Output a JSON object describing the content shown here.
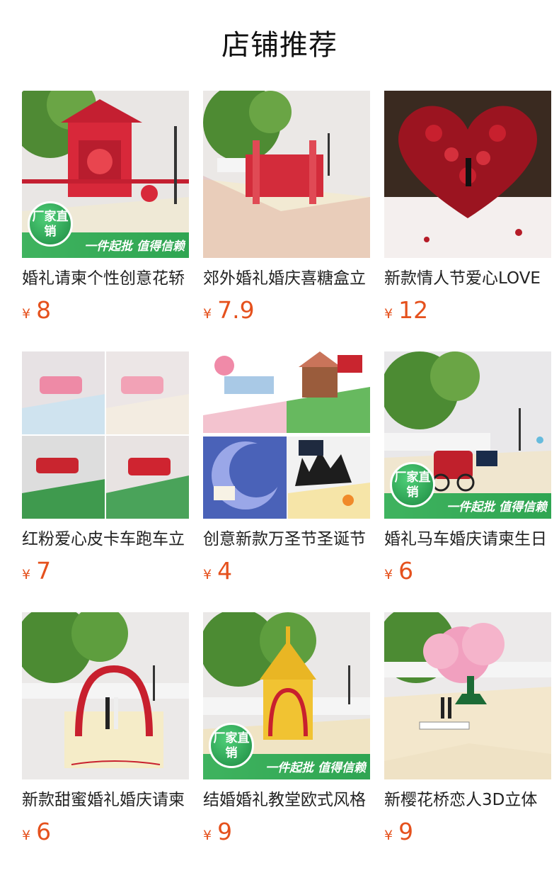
{
  "page_title": "店铺推荐",
  "badge": {
    "circle_text": "厂家直销",
    "bar_text": "一件起批 值得信赖"
  },
  "currency": "¥",
  "products": [
    {
      "name": "婚礼请柬个性创意花轿",
      "price": "8",
      "badge": true
    },
    {
      "name": "郊外婚礼婚庆喜糖盒立",
      "price": "7.9",
      "badge": false
    },
    {
      "name": "新款情人节爱心LOVE",
      "price": "12",
      "badge": false
    },
    {
      "name": "红粉爱心皮卡车跑车立",
      "price": "7",
      "badge": false
    },
    {
      "name": "创意新款万圣节圣诞节",
      "price": "4",
      "badge": false
    },
    {
      "name": "婚礼马车婚庆请柬生日",
      "price": "6",
      "badge": true
    },
    {
      "name": "新款甜蜜婚礼婚庆请柬",
      "price": "6",
      "badge": false
    },
    {
      "name": "结婚婚礼教堂欧式风格",
      "price": "9",
      "badge": true
    },
    {
      "name": "新樱花桥恋人3D立体",
      "price": "9",
      "badge": false
    }
  ]
}
